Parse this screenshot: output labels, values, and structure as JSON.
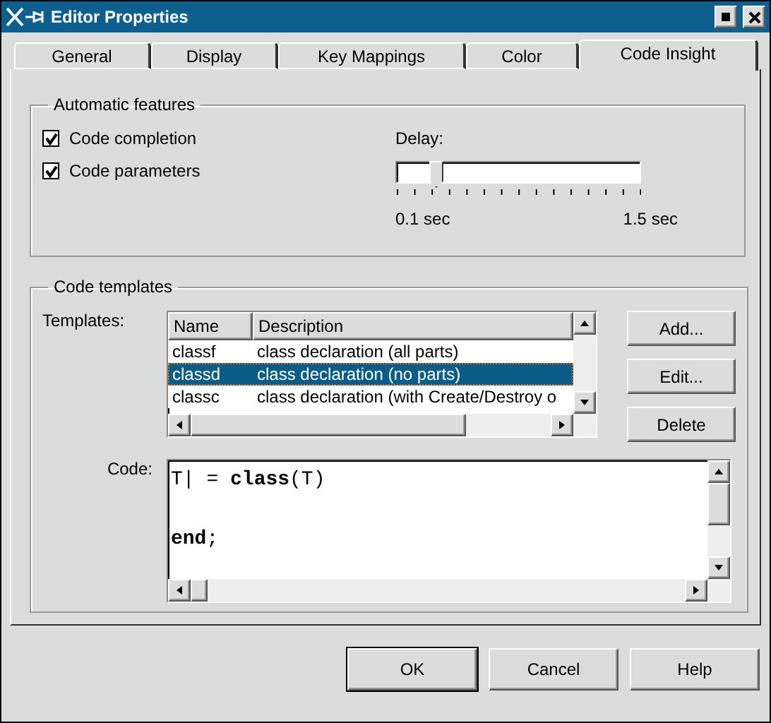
{
  "window": {
    "title": "Editor Properties"
  },
  "tabs": [
    {
      "label": "General",
      "selected": false
    },
    {
      "label": "Display",
      "selected": false
    },
    {
      "label": "Key Mappings",
      "selected": false
    },
    {
      "label": "Color",
      "selected": false
    },
    {
      "label": "Code Insight",
      "selected": true
    }
  ],
  "automatic_features": {
    "title": "Automatic features",
    "options": [
      {
        "label": "Code completion",
        "checked": true
      },
      {
        "label": "Code parameters",
        "checked": true
      }
    ],
    "delay": {
      "label": "Delay:",
      "level": 0.14,
      "min_label": "0.1 sec",
      "max_label": "1.5 sec"
    }
  },
  "code_templates": {
    "title": "Code templates",
    "templates_label": "Templates:",
    "columns": [
      "Name",
      "Description"
    ],
    "rows": [
      {
        "name": "classf",
        "description": "class declaration (all parts)",
        "selected": false
      },
      {
        "name": "classd",
        "description": "class declaration (no parts)",
        "selected": true
      },
      {
        "name": "classc",
        "description": "class declaration (with Create/Destroy o",
        "selected": false
      }
    ],
    "buttons": [
      "Add...",
      "Edit...",
      "Delete"
    ],
    "code_label": "Code:",
    "code_lines": [
      "T| = **class**(T)",
      "**end**;"
    ]
  },
  "buttons": [
    {
      "label": "OK",
      "default": true
    },
    {
      "label": "Cancel",
      "default": false
    },
    {
      "label": "Help",
      "default": false
    }
  ]
}
